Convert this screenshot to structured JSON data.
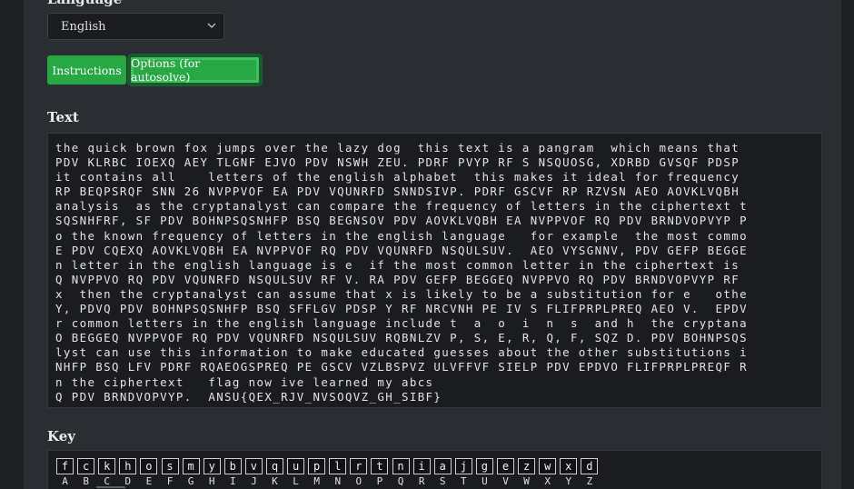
{
  "language": {
    "label": "Language",
    "selected": "English"
  },
  "buttons": {
    "instructions": "Instructions",
    "options": "Options (for autosolve)"
  },
  "text_section": {
    "title": "Text",
    "lines": [
      "the quick brown fox jumps over the lazy dog  this text is a pangram  which means that",
      "PDV KLRBC IOEXQ AEY TLGNF EJVO PDV NSWH ZEU. PDRF PVYP RF S NSQUOSG, XDRBD GVSQF PDSP",
      "it contains all    letters of the english alphabet  this makes it ideal for frequency",
      "RP BEQPSRQF SNN 26 NVPPVOF EA PDV VQUNRFD SNNDSIVP. PDRF GSCVF RP RZVSN AEO AOVKLVQBH",
      "analysis  as the cryptanalyst can compare the frequency of letters in the ciphertext t",
      "SQSNHFRF, SF PDV BOHNPSQSNHFP BSQ BEGNSOV PDV AOVKLVQBH EA NVPPVOF RQ PDV BRNDVOPVYP P",
      "o the known frequency of letters in the english language   for example  the most commo",
      "E PDV CQEXQ AOVKLVQBH EA NVPPVOF RQ PDV VQUNRFD NSQULSUV.  AEO VYSGNNV, PDV GEFP BEGGE",
      "n letter in the english language is e  if the most common letter in the ciphertext is",
      "Q NVPPVO RQ PDV VQUNRFD NSQULSUV RF V. RA PDV GEFP BEGGEQ NVPPVO RQ PDV BRNDVOPVYP RF",
      "x  then the cryptanalyst can assume that x is likely to be a substitution for e   othe",
      "Y, PDVQ PDV BOHNPSQSNHFP BSQ SFFLGV PDSP Y RF NRCVNH PE IV S FLIFPRPLPREQ AEO V.  EPDV",
      "r common letters in the english language include t  a  o  i  n  s  and h  the cryptana",
      "O BEGGEQ NVPPVOF RQ PDV VQUNRFD NSQULSUV RQBNLZV P, S, E, R, Q, F, SQZ D. PDV BOHNPSQS",
      "lyst can use this information to make educated guesses about the other substitutions i",
      "NHFP BSQ LFV PDRF RQAEOGSPREQ PE GSCV VZLBSPVZ ULVFFVF SIELP PDV EPDVO FLIFPRPLPREQF R",
      "n the ciphertext   flag now ive learned my abcs",
      "Q PDV BRNDVOPVYP.  ANSU{QEX_RJV_NVSOQVZ_GH_SIBF}"
    ]
  },
  "key_section": {
    "title": "Key",
    "plain": [
      "f",
      "c",
      "k",
      "h",
      "o",
      "s",
      "m",
      "y",
      "b",
      "v",
      "q",
      "u",
      "p",
      "l",
      "r",
      "t",
      "n",
      "i",
      "a",
      "j",
      "g",
      "e",
      "z",
      "w",
      "x",
      "d"
    ],
    "cipher": [
      "A",
      "B",
      "C",
      "D",
      "E",
      "F",
      "G",
      "H",
      "I",
      "J",
      "K",
      "L",
      "M",
      "N",
      "O",
      "P",
      "Q",
      "R",
      "S",
      "T",
      "U",
      "V",
      "W",
      "X",
      "Y",
      "Z"
    ]
  },
  "colors": {
    "button_green": "#28a745",
    "background": "#1e2124",
    "panel": "#2a2e32",
    "textbox": "#1a1c1f"
  }
}
